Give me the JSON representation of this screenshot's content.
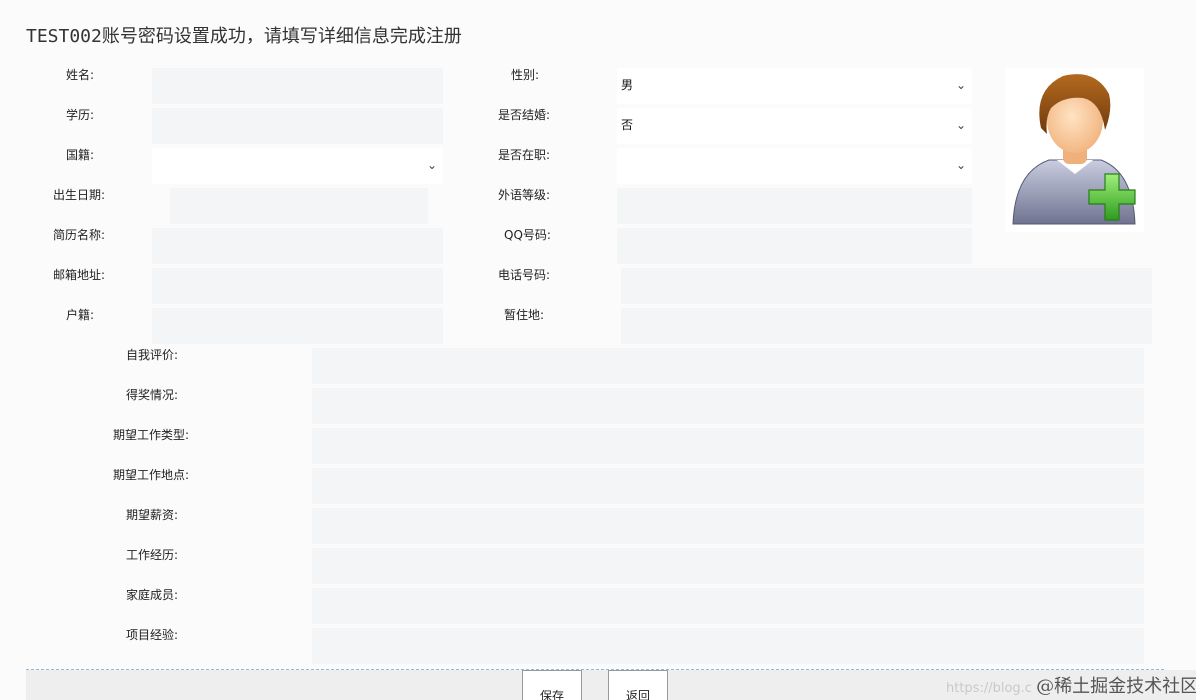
{
  "header": {
    "title": "TEST002账号密码设置成功，请填写详细信息完成注册"
  },
  "form": {
    "left_labels": [
      "姓名:",
      "学历:",
      "国籍:",
      "出生日期:",
      "简历名称:",
      "邮箱地址:",
      "户籍:"
    ],
    "right_labels": [
      "性别:",
      "是否结婚:",
      "是否在职:",
      "外语等级:",
      "QQ号码:",
      "电话号码:",
      "暂住地:"
    ],
    "gender_value": "男",
    "married_value": "否",
    "employed_value": "",
    "nationality_value": "",
    "wide_labels": [
      "自我评价:",
      "得奖情况:",
      "期望工作类型:",
      "期望工作地点:",
      "期望薪资:",
      "工作经历:",
      "家庭成员:",
      "项目经验:"
    ]
  },
  "buttons": {
    "save": "保存",
    "back": "返回"
  },
  "watermark": {
    "url": "https://blog.c",
    "brand": "@稀土掘金技术社区"
  },
  "colors": {
    "field_bg": "#f4f5f7",
    "page_bg": "#fbfbfb",
    "footer_line": "#8fb9d8"
  },
  "icons": {
    "avatar": "user-add-icon",
    "dropdown": "chevron-down-icon"
  }
}
